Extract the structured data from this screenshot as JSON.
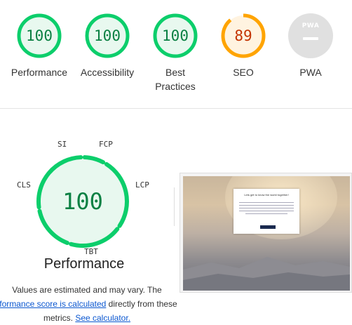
{
  "categories": [
    {
      "score": "100",
      "label": "Performance",
      "status": "pass",
      "fraction": 1.0,
      "color": "#0cce6b"
    },
    {
      "score": "100",
      "label": "Accessibility",
      "status": "pass",
      "fraction": 1.0,
      "color": "#0cce6b"
    },
    {
      "score": "100",
      "label": "Best Practices",
      "status": "pass",
      "fraction": 1.0,
      "color": "#0cce6b"
    },
    {
      "score": "89",
      "label": "SEO",
      "status": "average",
      "fraction": 0.89,
      "color": "#ffa400"
    },
    {
      "score": "",
      "label": "PWA",
      "status": "na",
      "badge_text": "PWA",
      "color": "#cccccc"
    }
  ],
  "performance": {
    "score": "100",
    "title": "Performance",
    "metrics": [
      "SI",
      "FCP",
      "LCP",
      "TBT",
      "CLS"
    ],
    "note_line1": "Values are estimated and may vary. The",
    "note_link": "rformance score is calculated",
    "note_after_link": " directly from these",
    "note_line3_start": "metrics. ",
    "note_line3_link": "See calculator.",
    "pass_color": "#0cce6b",
    "pass_text_color": "#0b8043",
    "pass_fill": "#e8f8ef"
  },
  "screenshot": {
    "dialog_title": "Lets get to know the world together!"
  }
}
